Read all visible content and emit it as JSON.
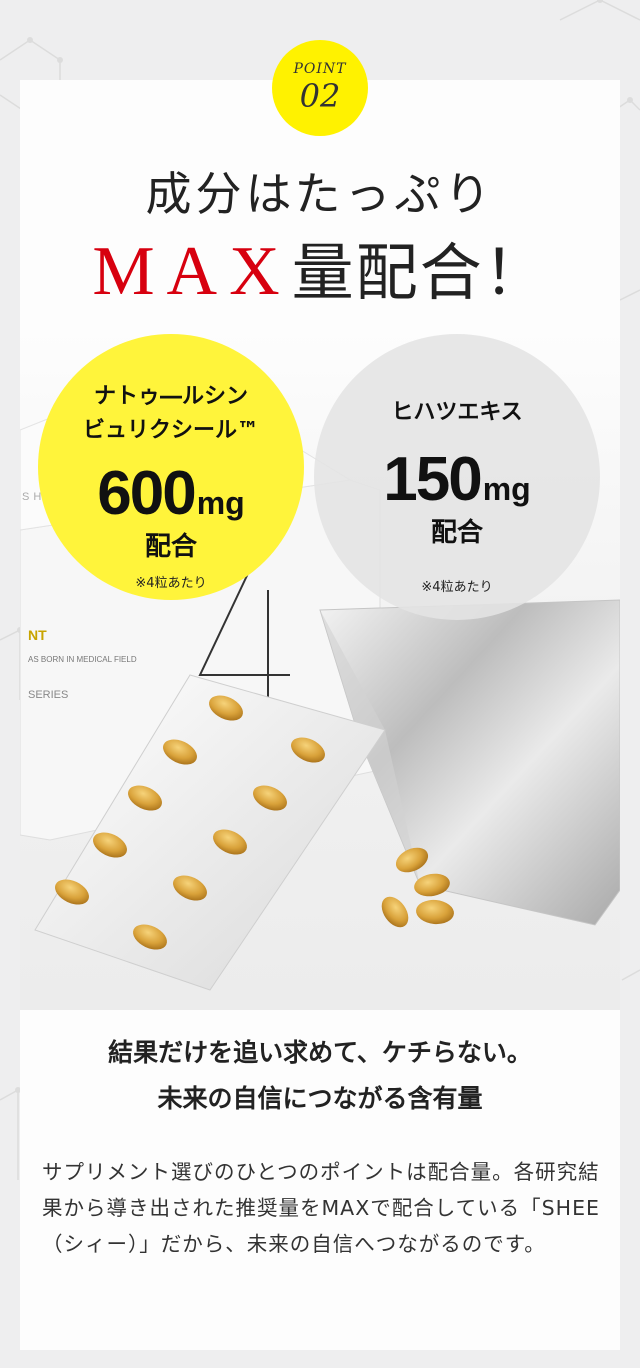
{
  "point": {
    "label": "POINT",
    "number": "02"
  },
  "headline": {
    "line1": "成分はたっぷり",
    "accent": "MAX",
    "line2_rest": "量配合！"
  },
  "ingredients": [
    {
      "name_line1": "ナトゥ―ルシン",
      "name_line2": "ビュリクシール™",
      "amount": "600",
      "unit": "mg",
      "suffix": "配合",
      "note": "※4粒あたり"
    },
    {
      "name_line1": "ヒハツエキス",
      "amount": "150",
      "unit": "mg",
      "suffix": "配合",
      "note": "※4粒あたり"
    }
  ],
  "package_print": {
    "brand": "SHEE",
    "line_a": "NT",
    "line_b": "AS BORN IN MEDICAL FIELD",
    "line_c": "SERIES"
  },
  "subheading": {
    "line1": "結果だけを追い求めて、ケチらない。",
    "line2": "未来の自信につながる含有量"
  },
  "body": "サプリメント選びのひとつのポイントは配合量。各研究結果から導き出された推奨量をMAXで配合している「SHEE（シィー）」だから、未来の自信へつながるのです。",
  "colors": {
    "badge_yellow": "#fff200",
    "circle_yellow": "#fff43b",
    "accent_red": "#d7000f",
    "capsule": "#d9a23a",
    "circle_gray": "#e4e4e4"
  }
}
